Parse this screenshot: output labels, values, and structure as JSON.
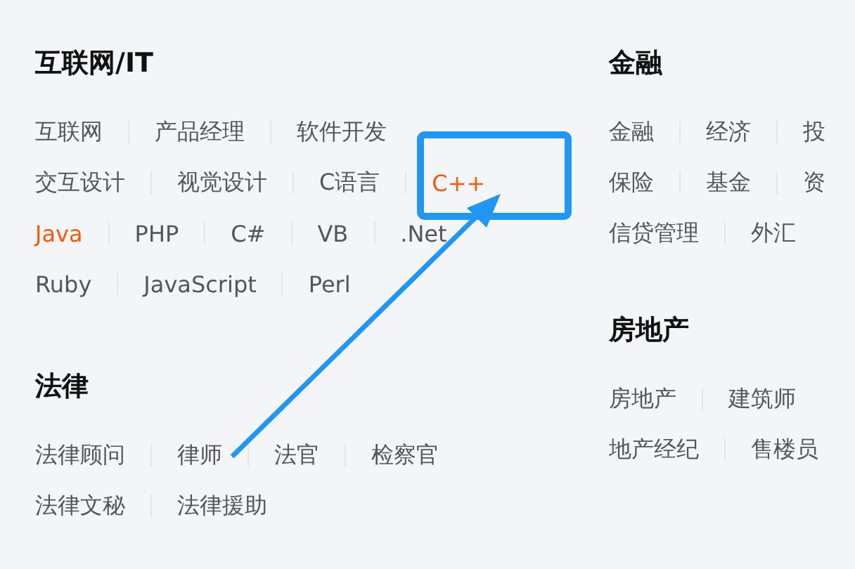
{
  "columns": [
    {
      "sections": [
        {
          "title": "互联网/IT",
          "lines": [
            {
              "items": [
                {
                  "label": "互联网",
                  "active": false
                },
                {
                  "label": "产品经理",
                  "active": false
                },
                {
                  "label": "软件开发",
                  "active": false
                }
              ]
            },
            {
              "items": [
                {
                  "label": "交互设计",
                  "active": false
                },
                {
                  "label": "视觉设计",
                  "active": false
                },
                {
                  "label": "C语言",
                  "active": false
                },
                {
                  "label": "C++",
                  "active": true
                }
              ]
            },
            {
              "items": [
                {
                  "label": "Java",
                  "active": true
                },
                {
                  "label": "PHP",
                  "active": false
                },
                {
                  "label": "C#",
                  "active": false
                },
                {
                  "label": "VB",
                  "active": false
                },
                {
                  "label": ".Net",
                  "active": false
                }
              ]
            },
            {
              "items": [
                {
                  "label": "Ruby",
                  "active": false
                },
                {
                  "label": "JavaScript",
                  "active": false
                },
                {
                  "label": "Perl",
                  "active": false
                }
              ]
            }
          ]
        },
        {
          "title": "法律",
          "lines": [
            {
              "items": [
                {
                  "label": "法律顾问",
                  "active": false
                },
                {
                  "label": "律师",
                  "active": false
                },
                {
                  "label": "法官",
                  "active": false
                },
                {
                  "label": "检察官",
                  "active": false
                }
              ]
            },
            {
              "items": [
                {
                  "label": "法律文秘",
                  "active": false
                },
                {
                  "label": "法律援助",
                  "active": false
                }
              ]
            }
          ]
        }
      ]
    },
    {
      "sections": [
        {
          "title": "金融",
          "lines": [
            {
              "items": [
                {
                  "label": "金融",
                  "active": false
                },
                {
                  "label": "经济",
                  "active": false
                },
                {
                  "label": "投",
                  "active": false
                }
              ]
            },
            {
              "items": [
                {
                  "label": "保险",
                  "active": false
                },
                {
                  "label": "基金",
                  "active": false
                },
                {
                  "label": "资",
                  "active": false
                }
              ]
            },
            {
              "items": [
                {
                  "label": "信贷管理",
                  "active": false
                },
                {
                  "label": "外汇",
                  "active": false
                }
              ]
            }
          ]
        },
        {
          "title": "房地产",
          "lines": [
            {
              "items": [
                {
                  "label": "房地产",
                  "active": false
                },
                {
                  "label": "建筑师",
                  "active": false
                }
              ]
            },
            {
              "items": [
                {
                  "label": "地产经纪",
                  "active": false
                },
                {
                  "label": "售楼员",
                  "active": false
                }
              ]
            }
          ]
        }
      ]
    }
  ]
}
